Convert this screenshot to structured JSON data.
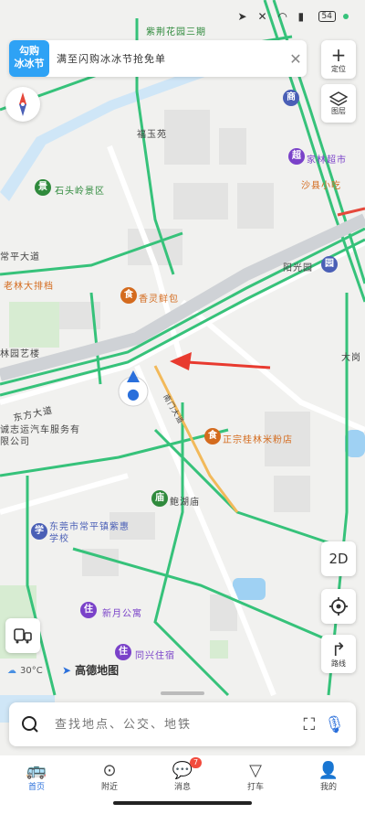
{
  "status_bar": {
    "battery": "54"
  },
  "banner": {
    "logo_line1": "勾购",
    "logo_line2": "冰冰节",
    "text": "满至闪购冰冰节抢免单"
  },
  "controls": {
    "layers_label": "图层",
    "mode_2d": "2D",
    "add_label": "定位",
    "nav_label": "路线"
  },
  "map_labels": {
    "place_1": "紫荆花园三期",
    "place_2": "福玉苑",
    "place_3": "石头岭景区",
    "place_4": "老林大排档",
    "place_5": "家林超市",
    "place_6": "沙县小吃",
    "place_7": "香灵鲜包",
    "place_8": "阳光园",
    "place_9": "正宗桂林米粉店",
    "place_10": "东莞市常平镇紫惠学校",
    "place_11": "新月公寓",
    "place_12": "同兴住宿",
    "place_13": "诚志运汽车服务有限公司",
    "place_14": "鲍湖庙",
    "place_15": "大岗",
    "place_16": "林园艺楼",
    "place_17": "常平大道",
    "place_18": "东方大道",
    "place_19": "南门大道"
  },
  "map_extra": {
    "weather": "30°C",
    "brand": "高德地图"
  },
  "search": {
    "placeholder": "查找地点、公交、地铁"
  },
  "tabs": [
    {
      "label": "首页"
    },
    {
      "label": "附近"
    },
    {
      "label": "消息",
      "badge": "7"
    },
    {
      "label": "打车"
    },
    {
      "label": "我的"
    }
  ]
}
